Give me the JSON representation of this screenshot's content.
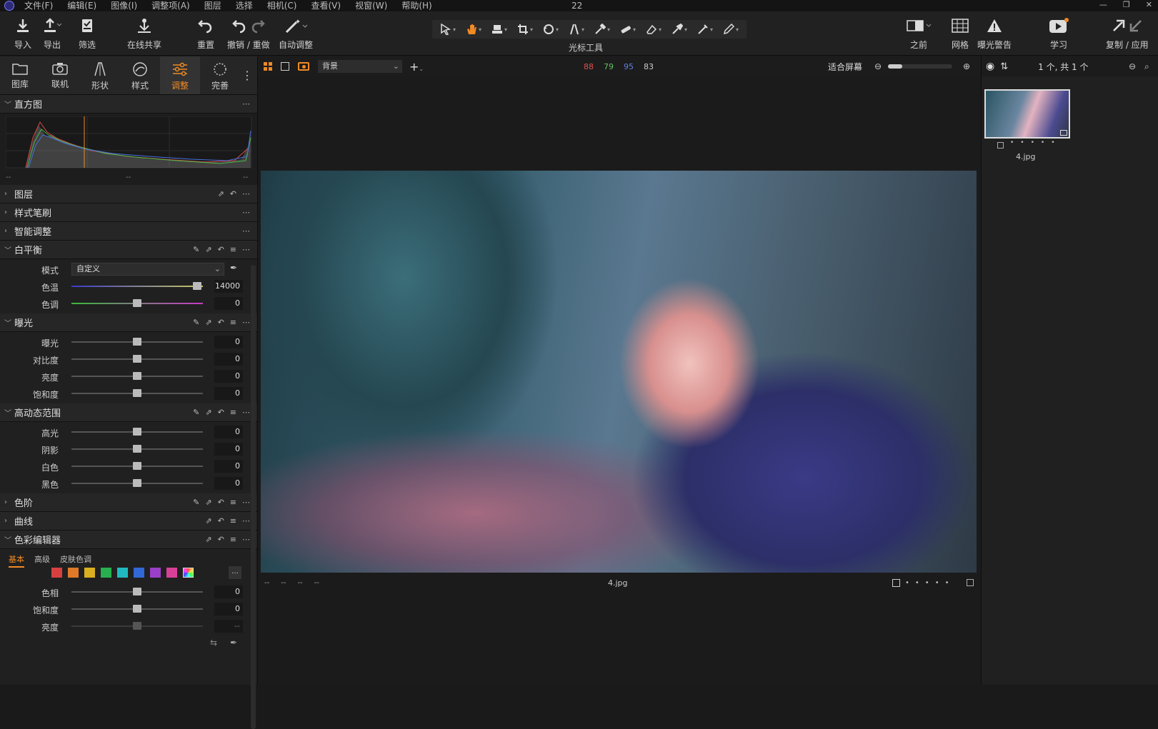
{
  "menu": {
    "items": [
      "文件(F)",
      "编辑(E)",
      "图像(I)",
      "调整项(A)",
      "图层",
      "选择",
      "相机(C)",
      "查看(V)",
      "视窗(W)",
      "帮助(H)"
    ],
    "center_number": "22"
  },
  "toolbar": {
    "import": "导入",
    "export": "导出",
    "filter": "筛选",
    "share": "在线共享",
    "reset": "重置",
    "undo_redo": "撤销 / 重做",
    "auto_adjust": "自动调整",
    "cursor_tools": "光标工具",
    "before": "之前",
    "grid": "网格",
    "exposure_warning": "曝光警告",
    "learn": "学习",
    "copy_apply": "复制 / 应用"
  },
  "tool_tabs": [
    "图库",
    "联机",
    "形状",
    "样式",
    "调整",
    "完善"
  ],
  "active_tab": "调整",
  "histogram": {
    "title": "直方图",
    "footer": [
      "--",
      "--",
      "--"
    ]
  },
  "sections": {
    "layers": "图层",
    "style_brush": "样式笔刷",
    "smart_adjust": "智能调整",
    "white_balance": "白平衡",
    "exposure": "曝光",
    "hdr": "高动态范围",
    "levels": "色阶",
    "curves": "曲线",
    "color_editor": "色彩编辑器"
  },
  "white_balance": {
    "mode_label": "模式",
    "mode_value": "自定义",
    "temp_label": "色温",
    "temp_value": "14000",
    "temp_pos": 0.95,
    "tint_label": "色调",
    "tint_value": "0",
    "tint_pos": 0.5
  },
  "exposure": [
    {
      "label": "曝光",
      "value": "0",
      "pos": 0.5
    },
    {
      "label": "对比度",
      "value": "0",
      "pos": 0.5
    },
    {
      "label": "亮度",
      "value": "0",
      "pos": 0.5
    },
    {
      "label": "饱和度",
      "value": "0",
      "pos": 0.5
    }
  ],
  "hdr": [
    {
      "label": "高光",
      "value": "0",
      "pos": 0.5
    },
    {
      "label": "阴影",
      "value": "0",
      "pos": 0.5
    },
    {
      "label": "白色",
      "value": "0",
      "pos": 0.5
    },
    {
      "label": "黑色",
      "value": "0",
      "pos": 0.5
    }
  ],
  "color_editor": {
    "tabs": [
      "基本",
      "高级",
      "皮肤色调"
    ],
    "active": "基本",
    "swatches": [
      "#d84040",
      "#e07a28",
      "#d8b020",
      "#28b050",
      "#20b8c0",
      "#3068d8",
      "#9a40c8",
      "#d84098"
    ],
    "rows": [
      {
        "label": "色相",
        "value": "0",
        "pos": 0.5
      },
      {
        "label": "饱和度",
        "value": "0",
        "pos": 0.5
      },
      {
        "label": "亮度",
        "value": "--",
        "pos": 0.5
      }
    ],
    "more": "..."
  },
  "canvas": {
    "layer": "背景",
    "rgb": {
      "r": "88",
      "g": "79",
      "b": "95",
      "a": "83"
    },
    "fit": "适合屏幕",
    "filename": "4.jpg",
    "meta": [
      "--",
      "--",
      "--",
      "--"
    ]
  },
  "browser": {
    "count": "1 个, 共 1 个",
    "thumb_name": "4.jpg"
  },
  "colors": {
    "accent": "#f08a24"
  }
}
